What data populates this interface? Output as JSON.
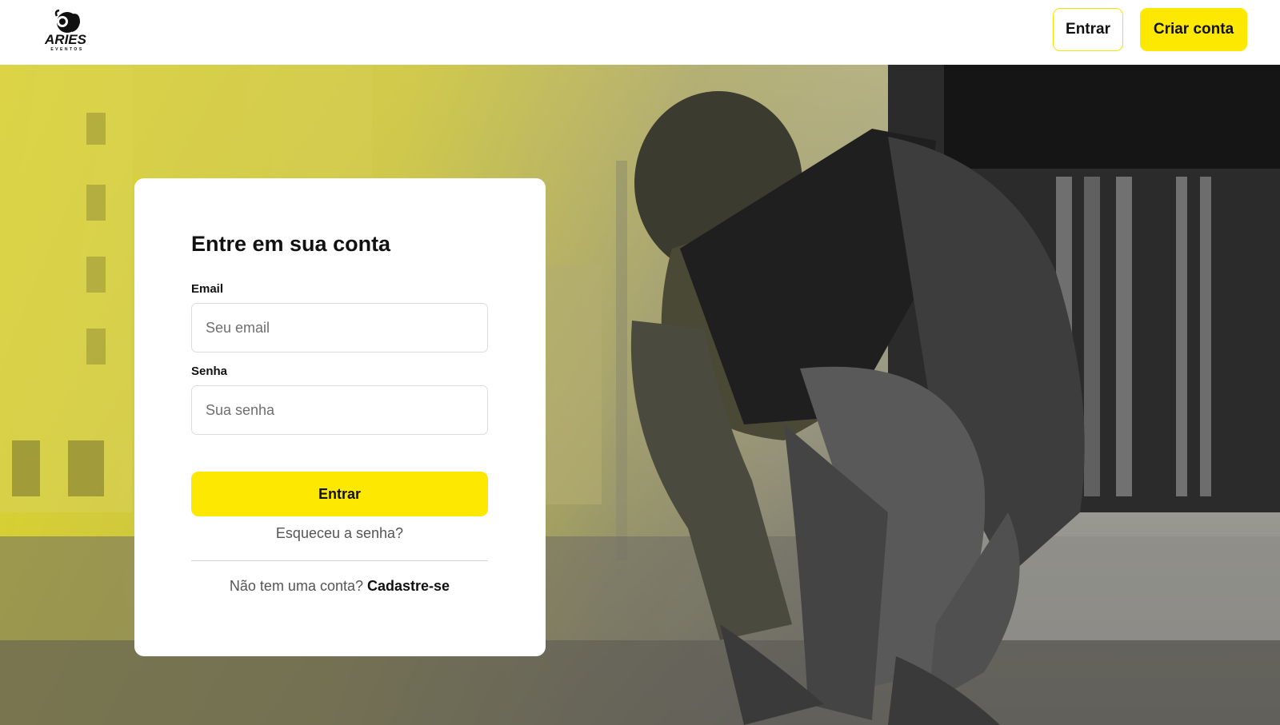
{
  "header": {
    "logo_text": "ARIES",
    "logo_subtext": "EVENTOS",
    "login_label": "Entrar",
    "signup_label": "Criar conta"
  },
  "login_form": {
    "title": "Entre em sua conta",
    "email": {
      "label": "Email",
      "placeholder": "Seu email",
      "value": ""
    },
    "password": {
      "label": "Senha",
      "placeholder": "Sua senha",
      "value": ""
    },
    "submit_label": "Entrar",
    "forgot_password": "Esqueceu a senha?",
    "no_account_text": "Não tem uma conta?",
    "signup_link": "Cadastre-se"
  },
  "theme": {
    "accent": "#fce800",
    "text": "#111111",
    "muted_text": "#555555",
    "card_background": "#ffffff"
  },
  "icons": [
    "ram-logo-icon"
  ]
}
